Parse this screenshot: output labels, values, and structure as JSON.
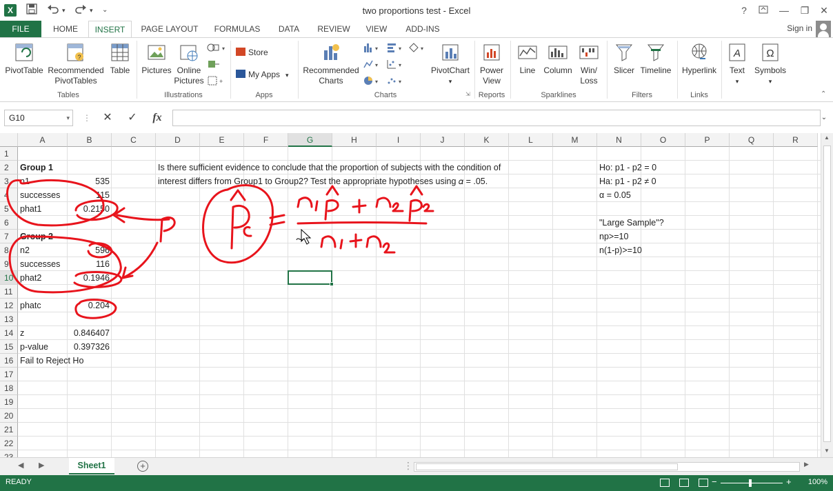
{
  "window": {
    "title": "two proportions test - Excel",
    "app_badge": "X",
    "help": "?",
    "minimize": "—",
    "restore": "❐",
    "close": "✕"
  },
  "qat": {
    "save": "💾",
    "undo": "↶",
    "redo": "↷",
    "customize": "⌄"
  },
  "tabs": {
    "file": "FILE",
    "items": [
      "HOME",
      "INSERT",
      "PAGE LAYOUT",
      "FORMULAS",
      "DATA",
      "REVIEW",
      "VIEW",
      "ADD-INS"
    ],
    "active": "INSERT",
    "signin": "Sign in"
  },
  "ribbon": {
    "pivottable": "PivotTable",
    "recommended_pivottables": "Recommended PivotTables",
    "table": "Table",
    "tables_group": "Tables",
    "pictures": "Pictures",
    "online_pictures": "Online Pictures",
    "illustrations_group": "Illustrations",
    "store": "Store",
    "my_apps": "My Apps",
    "apps_group": "Apps",
    "recommended_charts": "Recommended Charts",
    "pivotchart": "PivotChart",
    "charts_group": "Charts",
    "power_view": "Power View",
    "reports_group": "Reports",
    "line": "Line",
    "column": "Column",
    "winloss": "Win/ Loss",
    "sparklines_group": "Sparklines",
    "slicer": "Slicer",
    "timeline": "Timeline",
    "filters_group": "Filters",
    "hyperlink": "Hyperlink",
    "links_group": "Links",
    "text": "Text",
    "symbols": "Symbols"
  },
  "formula_bar": {
    "name_box": "G10",
    "cancel": "✕",
    "enter": "✓",
    "fx": "fx",
    "formula": ""
  },
  "columns": [
    "A",
    "B",
    "C",
    "D",
    "E",
    "F",
    "G",
    "H",
    "I",
    "J",
    "K",
    "L",
    "M",
    "N",
    "O",
    "P",
    "Q",
    "R"
  ],
  "selected_column": "G",
  "rows": [
    "1",
    "2",
    "3",
    "4",
    "5",
    "6",
    "7",
    "8",
    "9",
    "10",
    "11",
    "12",
    "13",
    "14",
    "15",
    "16",
    "17",
    "18",
    "19",
    "20",
    "21",
    "22",
    "23"
  ],
  "selected_row": "10",
  "cells": {
    "A2": "Group 1",
    "A3": "n1",
    "B3": "535",
    "A4": "successes",
    "B4": "115",
    "A5": "phat1",
    "B5": "0.2150",
    "A7": "Group 2",
    "A8": "n2",
    "B8": "596",
    "A9": "successes",
    "B9": "116",
    "A10": "phat2",
    "B10": "0.1946",
    "A12": "phatc",
    "B12": "0.204",
    "A14": "z",
    "B14": "0.846407",
    "A15": "p-value",
    "B15": "0.397326",
    "A16": "Fail to Reject Ho",
    "D2": "Is there sufficient evidence to conclude that the proportion of subjects with the condition of",
    "D3": "interest differs from Group1 to Group2? Test the appropriate hypotheses using 𝛼 = .05.",
    "N2": "Ho: p1 - p2 = 0",
    "N3": "Ha: p1 - p2 ≠ 0",
    "N4": "α = 0.05",
    "N6": "\"Large Sample\"?",
    "N7": "np>=10",
    "N8": "n(1-p)>=10"
  },
  "sheets": {
    "active": "Sheet1",
    "add": "+"
  },
  "status": {
    "mode": "READY",
    "zoom": "100%",
    "zoom_minus": "−",
    "zoom_plus": "+"
  },
  "colors": {
    "accent": "#217346",
    "ink": "#e8141c"
  }
}
